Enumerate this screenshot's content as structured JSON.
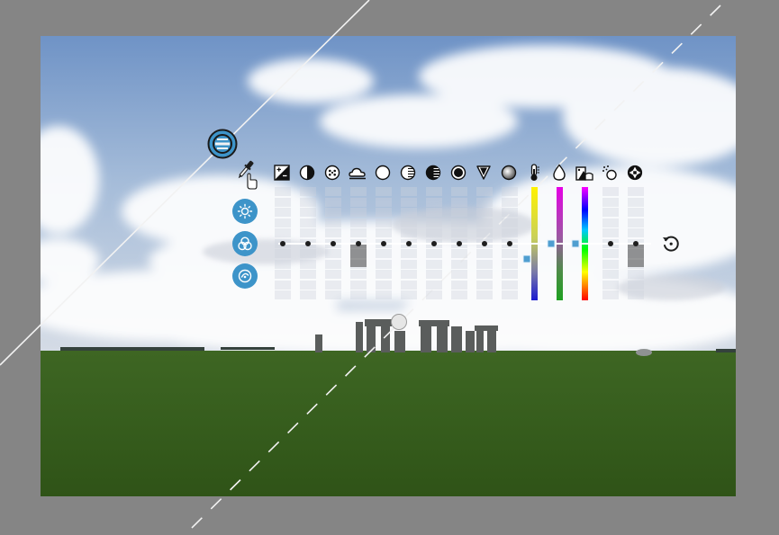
{
  "window": {
    "frame_color": "#858585",
    "accent_color": "#3d94c9"
  },
  "tools": [
    {
      "name": "brightness-tool",
      "icon": "sun-icon"
    },
    {
      "name": "color-tool",
      "icon": "rgb-circles-icon"
    },
    {
      "name": "curve-tool",
      "icon": "dial-icon"
    }
  ],
  "adjustments": [
    {
      "name": "exposure",
      "icon": "exposure-icon",
      "level": 0
    },
    {
      "name": "contrast",
      "icon": "contrast-icon",
      "level": 0
    },
    {
      "name": "brilliance",
      "icon": "dots-circle-icon",
      "level": 0
    },
    {
      "name": "haze",
      "icon": "cloud-sun-icon",
      "level": 0.42
    },
    {
      "name": "highlights",
      "icon": "circle-open-icon",
      "level": 0
    },
    {
      "name": "lights",
      "icon": "circle-lines-icon",
      "level": 0
    },
    {
      "name": "darks",
      "icon": "circle-half-lines-icon",
      "level": 0
    },
    {
      "name": "blacks",
      "icon": "circle-filled-icon",
      "level": 0
    },
    {
      "name": "fade",
      "icon": "triangle-down-icon",
      "level": 0
    },
    {
      "name": "vignette",
      "icon": "sphere-icon",
      "level": 0
    },
    {
      "name": "temperature",
      "icon": "thermometer-icon",
      "level": -0.3
    },
    {
      "name": "tint",
      "icon": "droplet-icon",
      "level": 0
    },
    {
      "name": "hue",
      "icon": "hue-mountain-icon",
      "level": 0
    },
    {
      "name": "sharpen",
      "icon": "sparkle-icon",
      "level": 0
    },
    {
      "name": "aperture",
      "icon": "aperture-icon",
      "level": 0.42
    }
  ],
  "controls": {
    "reset": "reset-icon",
    "pivot": "target-knob-icon",
    "picker": "eyedropper-icon",
    "rotation": "rotation-handle"
  }
}
